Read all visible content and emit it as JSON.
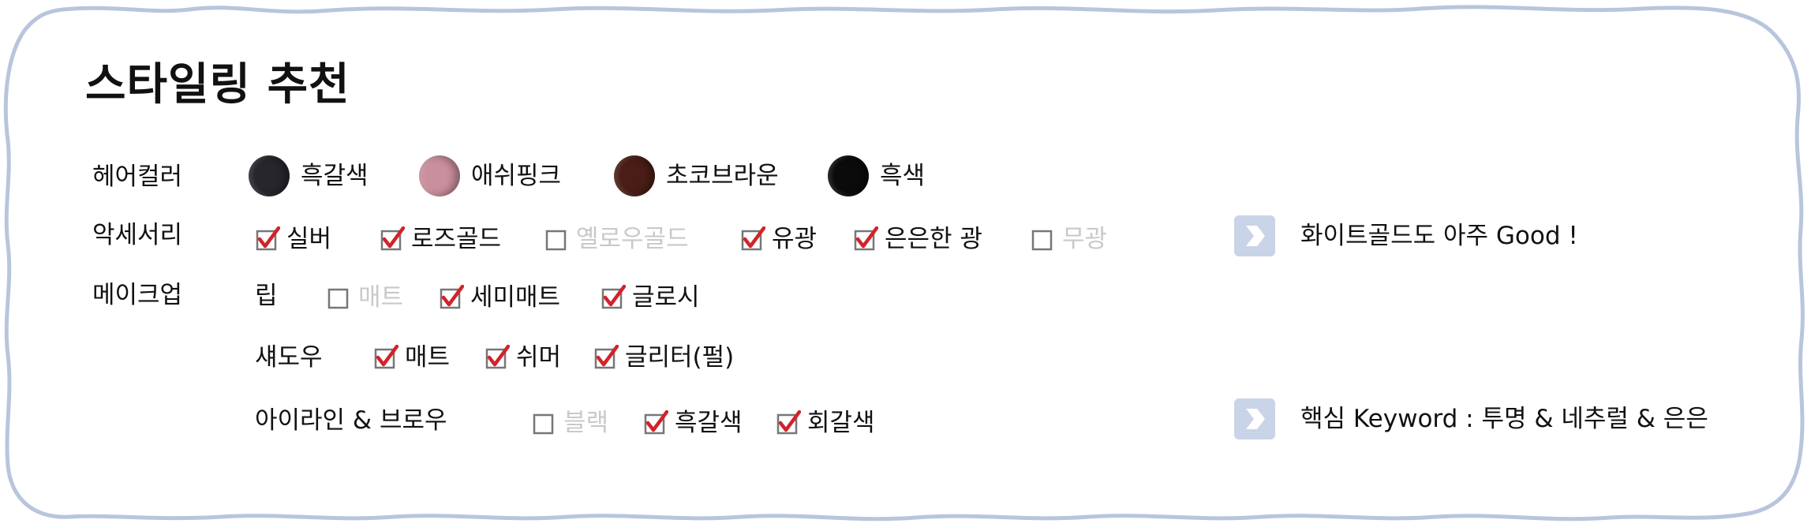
{
  "title": "스타일링 추천",
  "colors": {
    "frame": "#b8c5dc",
    "check": "#d2232a",
    "disabled_text": "#c9c9c9",
    "arrow_bg": "#c9d4e8"
  },
  "hair": {
    "label": "헤어컬러",
    "swatches": [
      {
        "label": "흑갈색",
        "color": "#26262c"
      },
      {
        "label": "애쉬핑크",
        "color": "#c98f9c"
      },
      {
        "label": "초코브라운",
        "color": "#4a1e16"
      },
      {
        "label": "흑색",
        "color": "#0b0b0b"
      }
    ]
  },
  "accessory": {
    "label": "악세서리",
    "options": [
      {
        "label": "실버",
        "checked": true
      },
      {
        "label": "로즈골드",
        "checked": true
      },
      {
        "label": "옐로우골드",
        "checked": false
      },
      {
        "label": "유광",
        "checked": true
      },
      {
        "label": "은은한 광",
        "checked": true
      },
      {
        "label": "무광",
        "checked": false
      }
    ],
    "note": "화이트골드도 아주 Good !",
    "note_icon": "chevron-right-icon"
  },
  "makeup": {
    "label": "메이크업",
    "lip": {
      "label": "립",
      "options": [
        {
          "label": "매트",
          "checked": false
        },
        {
          "label": "세미매트",
          "checked": true
        },
        {
          "label": "글로시",
          "checked": true
        }
      ]
    },
    "shadow": {
      "label": "섀도우",
      "options": [
        {
          "label": "매트",
          "checked": true
        },
        {
          "label": "쉬머",
          "checked": true
        },
        {
          "label": "글리터(펄)",
          "checked": true
        }
      ]
    },
    "liner": {
      "label": "아이라인 & 브로우",
      "options": [
        {
          "label": "블랙",
          "checked": false
        },
        {
          "label": "흑갈색",
          "checked": true
        },
        {
          "label": "회갈색",
          "checked": true
        }
      ]
    },
    "note": "핵심 Keyword : 투명 & 네추럴 & 은은",
    "note_icon": "chevron-right-icon"
  }
}
